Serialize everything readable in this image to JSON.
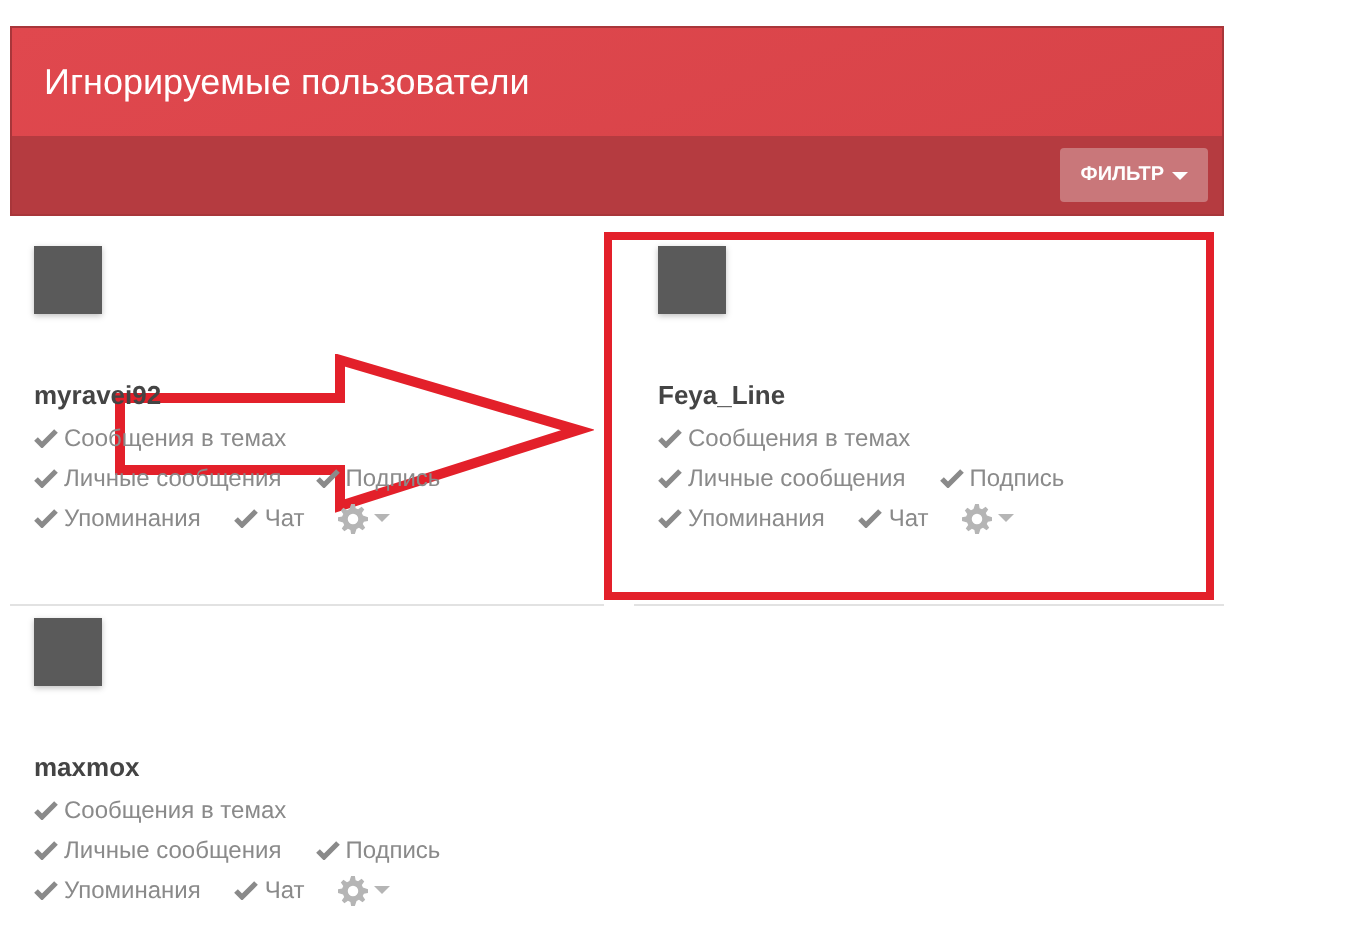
{
  "header": {
    "title": "Игнорируемые пользователи",
    "filter_button": "ФИЛЬТР"
  },
  "users": [
    {
      "name": "myravei92",
      "permission_rows": [
        [
          {
            "label": "Сообщения в темах",
            "checked": true
          }
        ],
        [
          {
            "label": "Личные сообщения",
            "checked": true
          },
          {
            "label": "Подпись",
            "checked": true
          }
        ],
        [
          {
            "label": "Упоминания",
            "checked": true
          },
          {
            "label": "Чат",
            "checked": true
          }
        ]
      ]
    },
    {
      "name": "Feya_Line",
      "permission_rows": [
        [
          {
            "label": "Сообщения в темах",
            "checked": true
          }
        ],
        [
          {
            "label": "Личные сообщения",
            "checked": true
          },
          {
            "label": "Подпись",
            "checked": true
          }
        ],
        [
          {
            "label": "Упоминания",
            "checked": true
          },
          {
            "label": "Чат",
            "checked": true
          }
        ]
      ]
    },
    {
      "name": "maxmox",
      "permission_rows": [
        [
          {
            "label": "Сообщения в темах",
            "checked": true
          }
        ],
        [
          {
            "label": "Личные сообщения",
            "checked": true
          },
          {
            "label": "Подпись",
            "checked": true
          }
        ],
        [
          {
            "label": "Упоминания",
            "checked": true
          },
          {
            "label": "Чат",
            "checked": true
          }
        ]
      ]
    }
  ]
}
